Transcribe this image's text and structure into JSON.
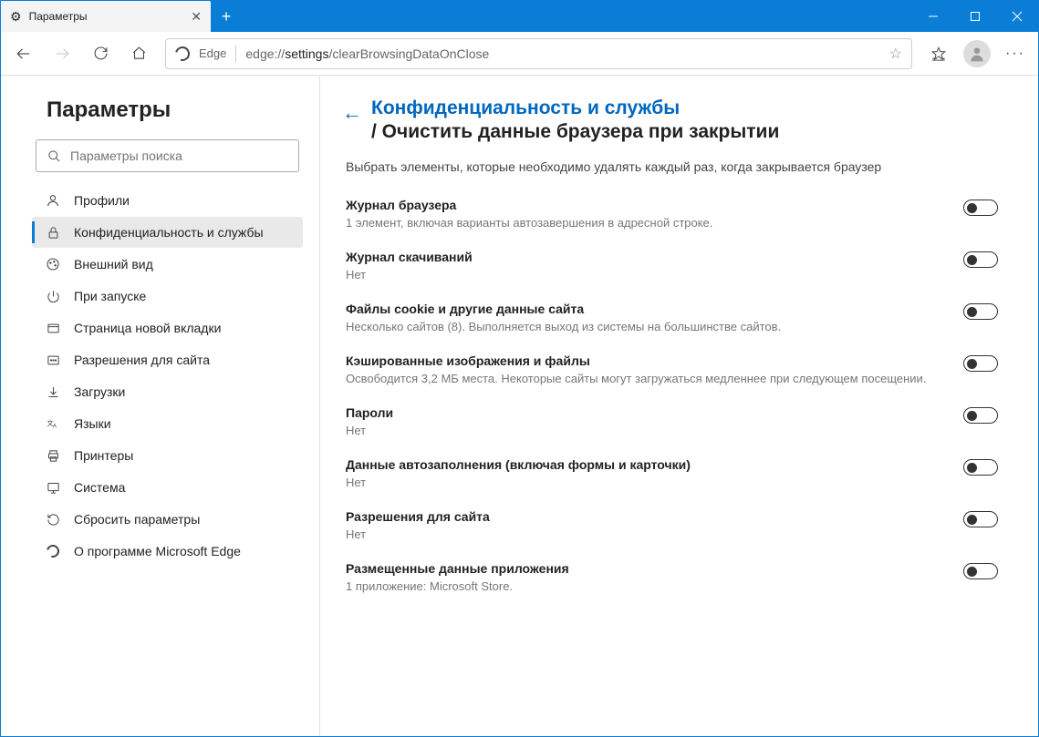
{
  "tab_title": "Параметры",
  "address_label": "Edge",
  "address_prefix": "edge://",
  "address_bold": "settings",
  "address_rest": "/clearBrowsingDataOnClose",
  "sidebar": {
    "title": "Параметры",
    "search_placeholder": "Параметры поиска",
    "items": [
      {
        "label": "Профили"
      },
      {
        "label": "Конфиденциальность и службы"
      },
      {
        "label": "Внешний вид"
      },
      {
        "label": "При запуске"
      },
      {
        "label": "Страница новой вкладки"
      },
      {
        "label": "Разрешения для сайта"
      },
      {
        "label": "Загрузки"
      },
      {
        "label": "Языки"
      },
      {
        "label": "Принтеры"
      },
      {
        "label": "Система"
      },
      {
        "label": "Сбросить параметры"
      },
      {
        "label": "О программе Microsoft Edge"
      }
    ]
  },
  "heading": {
    "line1": "Конфиденциальность и службы",
    "line2": "/ Очистить данные браузера при закрытии"
  },
  "description": "Выбрать элементы, которые необходимо удалять каждый раз, когда закрывается браузер",
  "options": [
    {
      "title": "Журнал браузера",
      "sub": "1 элемент, включая варианты автозавершения в адресной строке."
    },
    {
      "title": "Журнал скачиваний",
      "sub": "Нет"
    },
    {
      "title": "Файлы cookie и другие данные сайта",
      "sub": "Несколько сайтов (8). Выполняется выход из системы на большинстве сайтов."
    },
    {
      "title": "Кэшированные изображения и файлы",
      "sub": "Освободится 3,2 МБ места. Некоторые сайты могут загружаться медленнее при следующем посещении."
    },
    {
      "title": "Пароли",
      "sub": "Нет"
    },
    {
      "title": "Данные автозаполнения (включая формы и карточки)",
      "sub": "Нет"
    },
    {
      "title": "Разрешения для сайта",
      "sub": "Нет"
    },
    {
      "title": "Размещенные данные приложения",
      "sub": "1 приложение: Microsoft Store."
    }
  ]
}
